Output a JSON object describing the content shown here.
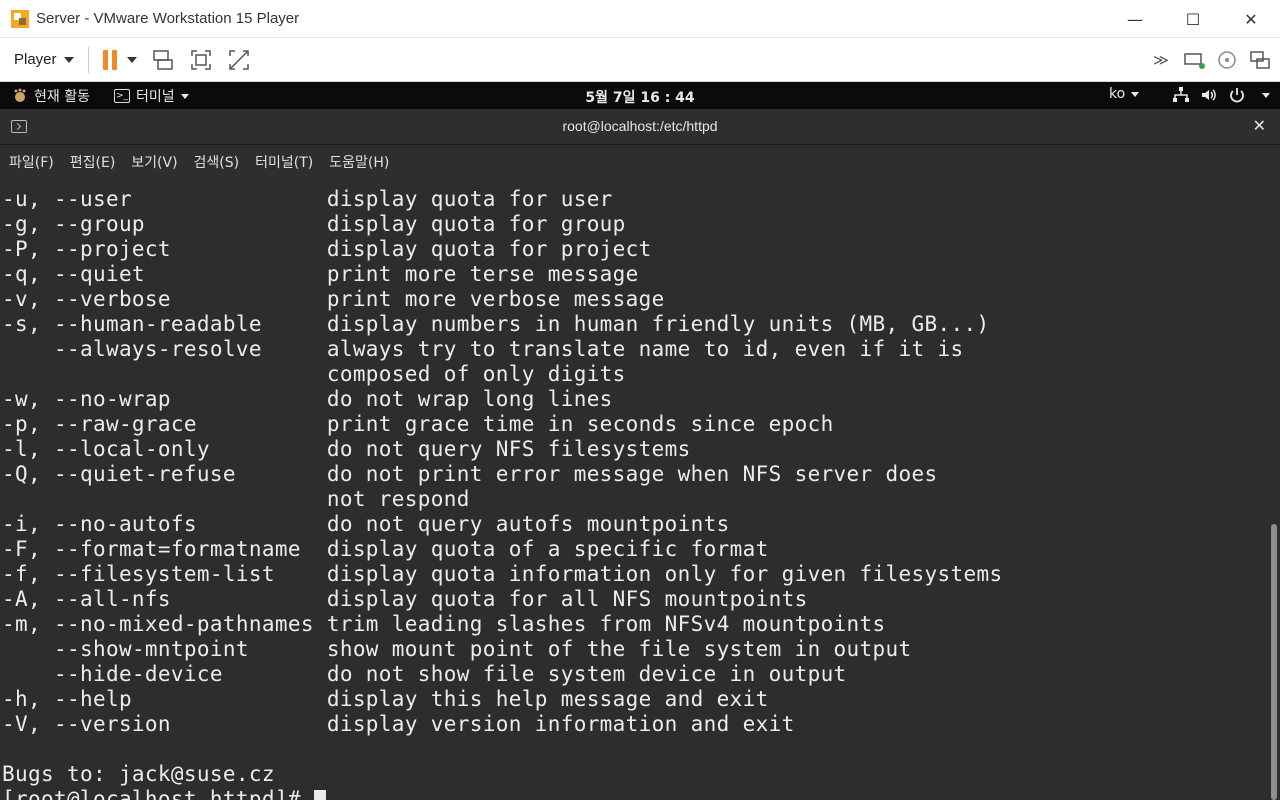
{
  "window": {
    "title": "Server - VMware Workstation 15 Player",
    "minimize": "—",
    "maximize": "☐",
    "close": "✕"
  },
  "vm_toolbar": {
    "player_menu": "Player"
  },
  "gnome_bar": {
    "activities": "현재 활동",
    "app_menu": "터미널",
    "clock": "5월 7일  16 : 44",
    "input_lang": "ko"
  },
  "terminal": {
    "title": "root@localhost:/etc/httpd",
    "menu": [
      "파일(F)",
      "편집(E)",
      "보기(V)",
      "검색(S)",
      "터미널(T)",
      "도움말(H)"
    ],
    "lines": [
      "-u, --user               display quota for user",
      "-g, --group              display quota for group",
      "-P, --project            display quota for project",
      "-q, --quiet              print more terse message",
      "-v, --verbose            print more verbose message",
      "-s, --human-readable     display numbers in human friendly units (MB, GB...)",
      "    --always-resolve     always try to translate name to id, even if it is",
      "                         composed of only digits",
      "-w, --no-wrap            do not wrap long lines",
      "-p, --raw-grace          print grace time in seconds since epoch",
      "-l, --local-only         do not query NFS filesystems",
      "-Q, --quiet-refuse       do not print error message when NFS server does",
      "                         not respond",
      "-i, --no-autofs          do not query autofs mountpoints",
      "-F, --format=formatname  display quota of a specific format",
      "-f, --filesystem-list    display quota information only for given filesystems",
      "-A, --all-nfs            display quota for all NFS mountpoints",
      "-m, --no-mixed-pathnames trim leading slashes from NFSv4 mountpoints",
      "    --show-mntpoint      show mount point of the file system in output",
      "    --hide-device        do not show file system device in output",
      "-h, --help               display this help message and exit",
      "-V, --version            display version information and exit",
      "",
      "Bugs to: jack@suse.cz"
    ],
    "prompt": "[root@localhost httpd]# "
  }
}
